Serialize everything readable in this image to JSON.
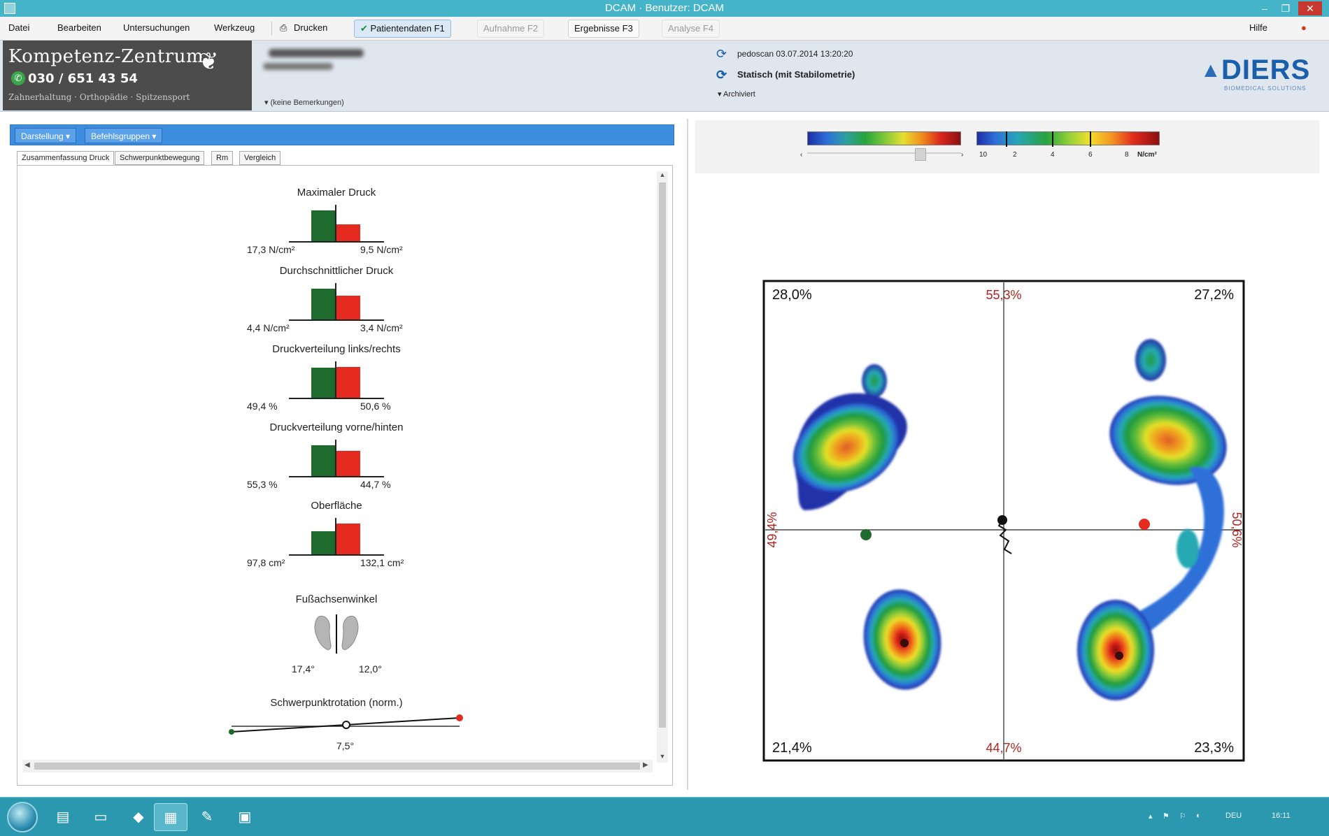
{
  "window": {
    "title": "DCAM · Benutzer: DCAM",
    "controls": [
      "–",
      "❐",
      "✕"
    ]
  },
  "menu": {
    "datei": "Datei",
    "bearbeiten": "Bearbeiten",
    "untersuchungen": "Untersuchungen",
    "werkzeug": "Werkzeug",
    "drucken": "Drucken",
    "tab_patientendaten": "Patientendaten F1",
    "tab_aufnahme": "Aufnahme F2",
    "tab_ergebnisse": "Ergebnisse F3",
    "tab_analyse": "Analyse F4",
    "help": "Hilfe"
  },
  "header": {
    "clinic_name": "Kompetenz-Zentrum",
    "phone": "030 / 651 43 54",
    "tagline": "Zahnerhaltung · Orthopädie · Spitzensport",
    "remarks": "(keine Bemerkungen)",
    "scan_date": "pedoscan 03.07.2014 13:20:20",
    "scan_type": "Statisch (mit Stabilometrie)",
    "archive": "Archiviert",
    "brand": "DIERS",
    "brand_sub": "BIOMEDICAL SOLUTIONS"
  },
  "left_panel": {
    "top_buttons": [
      "Darstellung ▾",
      "Befehlsgruppen ▾"
    ],
    "sub_tabs": [
      "Zusammenfassung Druck",
      "Schwerpunktbewegung",
      "Rm",
      "Vergleich"
    ]
  },
  "stats": [
    {
      "title": "Maximaler Druck",
      "left_label": "17,3 N/cm²",
      "right_label": "9,5 N/cm²",
      "left_val": 17.3,
      "right_val": 9.5
    },
    {
      "title": "Durchschnittlicher Druck",
      "left_label": "4,4 N/cm²",
      "right_label": "3,4 N/cm²",
      "left_val": 4.4,
      "right_val": 3.4
    },
    {
      "title": "Druckverteilung links/rechts",
      "left_label": "49,4 %",
      "right_label": "50,6 %",
      "left_val": 49.4,
      "right_val": 50.6
    },
    {
      "title": "Druckverteilung vorne/hinten",
      "left_label": "55,3 %",
      "right_label": "44,7 %",
      "left_val": 55.3,
      "right_val": 44.7
    },
    {
      "title": "Oberfläche",
      "left_label": "97,8 cm²",
      "right_label": "132,1 cm²",
      "left_val": 97.8,
      "right_val": 132.1
    }
  ],
  "foot_angle": {
    "title": "Fußachsenwinkel",
    "left": "17,4°",
    "right": "12,0°"
  },
  "cog_rotation": {
    "title": "Schwerpunktrotation (norm.)",
    "value": "7,5°"
  },
  "legend": {
    "left_scale_arrows": [
      "‹",
      "›"
    ],
    "right_ticks": [
      "10",
      "2",
      "4",
      "6",
      "8",
      "N/cm²"
    ]
  },
  "plot": {
    "top_left": "28,0%",
    "top_center": "55,3%",
    "top_right": "27,2%",
    "mid_left": "49,4%",
    "mid_right": "50,6%",
    "bottom_left": "21,4%",
    "bottom_center": "44,7%",
    "bottom_right": "23,3%"
  },
  "colors": {
    "left_foot": "#1e6b2e",
    "right_foot": "#e52b1f",
    "accent_blue": "#3e8ee0",
    "taskbar": "#2c98b0"
  },
  "taskbar": {
    "apps": [
      "folder-icon",
      "window-icon",
      "shield-icon",
      "active-window-icon",
      "pen-icon",
      "box-icon"
    ],
    "lang": "DEU",
    "time": "16:11"
  }
}
